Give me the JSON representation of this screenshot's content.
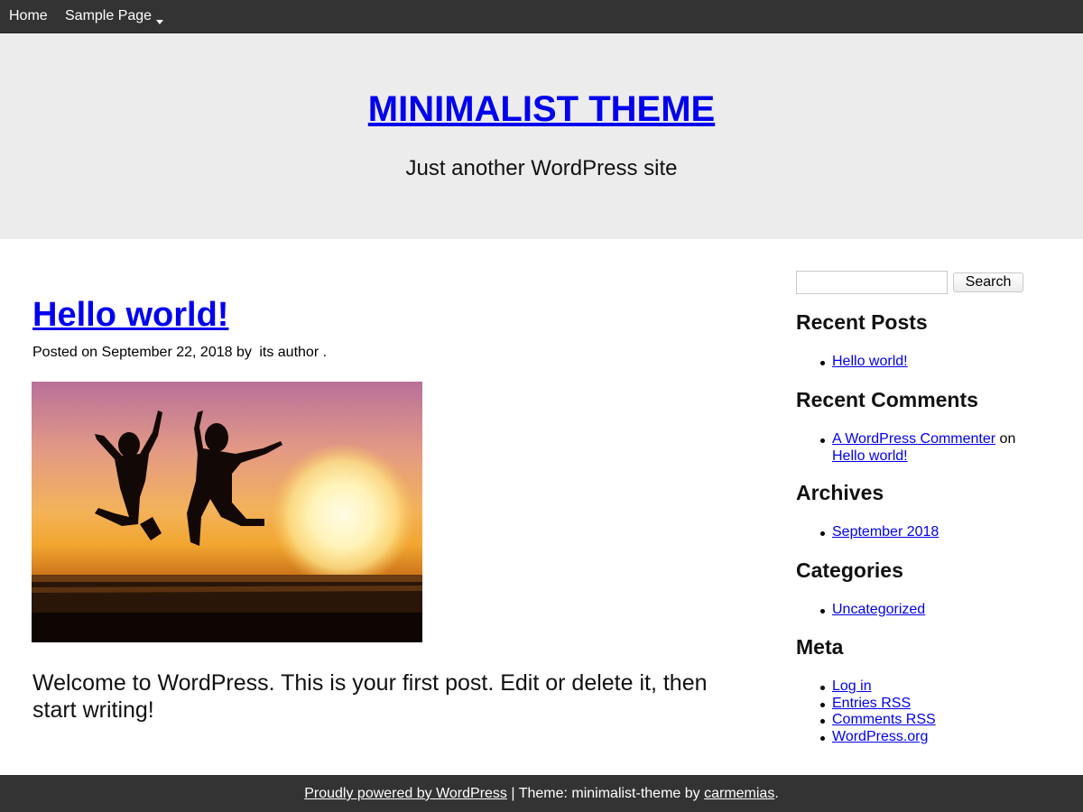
{
  "nav": {
    "items": [
      {
        "label": "Home"
      },
      {
        "label": "Sample Page"
      }
    ]
  },
  "header": {
    "title": "MINIMALIST THEME",
    "description": "Just another WordPress site"
  },
  "post": {
    "title": "Hello world!",
    "meta_prefix": "Posted on",
    "date": "September 22, 2018",
    "by": "by",
    "author": "its author",
    "meta_suffix": ".",
    "content": "Welcome to WordPress. This is your first post. Edit or delete it, then start writing!"
  },
  "sidebar": {
    "search_button": "Search",
    "search_value": "",
    "recent_posts": {
      "title": "Recent Posts",
      "items": [
        "Hello world!"
      ]
    },
    "recent_comments": {
      "title": "Recent Comments",
      "commenter": "A WordPress Commenter",
      "on": "on",
      "post": "Hello world!"
    },
    "archives": {
      "title": "Archives",
      "items": [
        "September 2018"
      ]
    },
    "categories": {
      "title": "Categories",
      "items": [
        "Uncategorized"
      ]
    },
    "meta": {
      "title": "Meta",
      "items": [
        "Log in",
        "Entries RSS",
        "Comments RSS",
        "WordPress.org"
      ]
    }
  },
  "footer": {
    "powered": "Proudly powered by WordPress",
    "separator": "| Theme: minimalist-theme by",
    "theme_author": "carmemias",
    "end": "."
  },
  "colors": {
    "link": "#0000ee",
    "nav_bg": "#333333",
    "header_bg": "#ececec"
  }
}
